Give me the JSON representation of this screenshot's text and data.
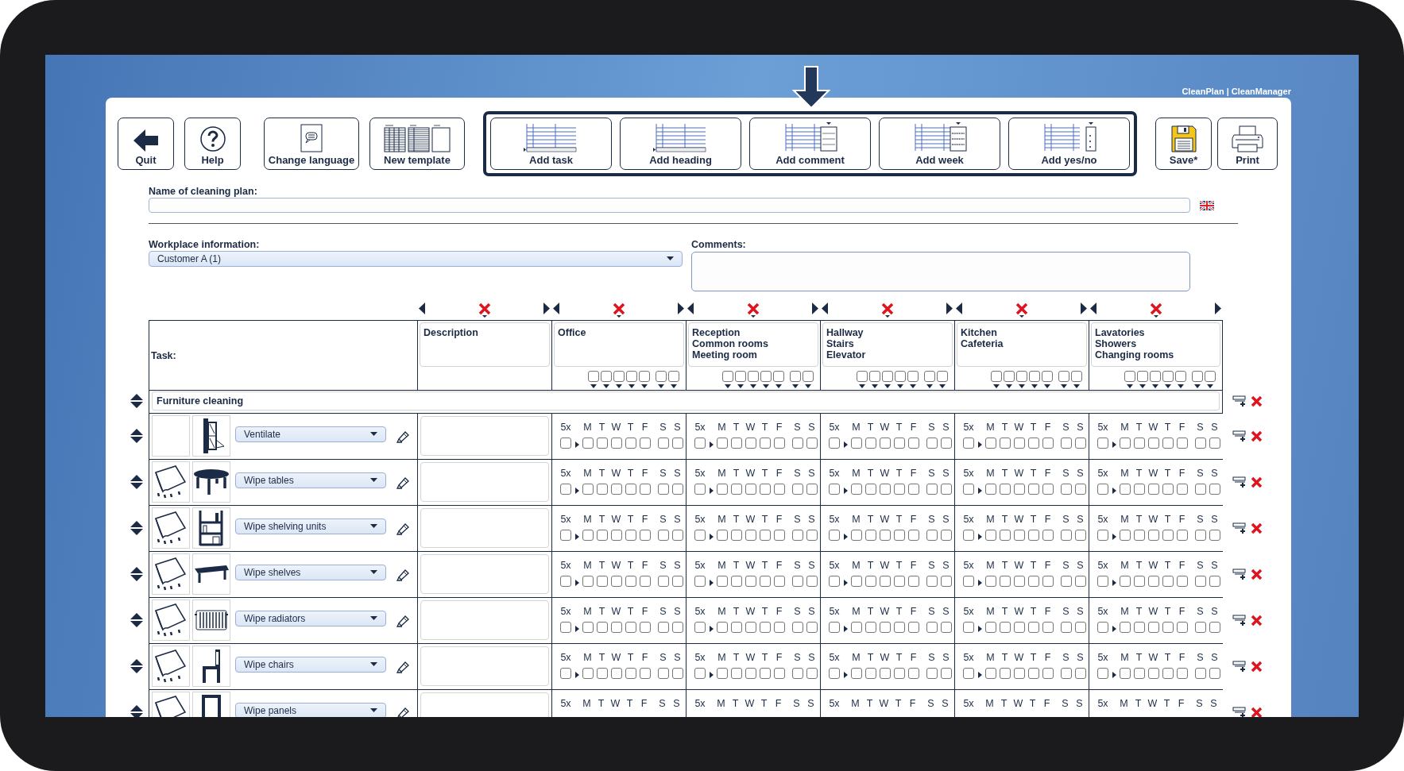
{
  "brand": "CleanPlan | CleanManager",
  "toolbar": {
    "left": [
      {
        "label": "Quit"
      },
      {
        "label": "Help"
      },
      {
        "label": "Change language"
      },
      {
        "label": "New template"
      }
    ],
    "group": [
      {
        "label": "Add task"
      },
      {
        "label": "Add heading"
      },
      {
        "label": "Add comment"
      },
      {
        "label": "Add week"
      },
      {
        "label": "Add yes/no"
      }
    ],
    "right": [
      {
        "label": "Save*"
      },
      {
        "label": "Print"
      }
    ]
  },
  "plan_name": {
    "label": "Name of cleaning plan:"
  },
  "workplace": {
    "label": "Workplace information:",
    "value": "Customer A (1)"
  },
  "comments": {
    "label": "Comments:"
  },
  "table": {
    "task_label": "Task:",
    "columns": [
      {
        "kind": "text",
        "title": "Description"
      },
      {
        "kind": "week",
        "title": "Office",
        "checked": [
          false,
          false,
          false,
          false,
          false,
          false,
          false
        ]
      },
      {
        "kind": "week",
        "title": "Reception\nCommon rooms\nMeeting room",
        "checked": [
          false,
          false,
          false,
          false,
          false,
          false,
          false
        ]
      },
      {
        "kind": "week",
        "title": "Hallway\nStairs\nElevator",
        "checked": [
          false,
          false,
          false,
          false,
          false,
          false,
          false
        ]
      },
      {
        "kind": "week",
        "title": "Kitchen\nCafeteria",
        "checked": [
          false,
          false,
          false,
          false,
          false,
          false,
          false
        ]
      },
      {
        "kind": "week",
        "title": "Lavatories\nShowers\nChanging rooms",
        "checked": [
          false,
          false,
          false,
          false,
          false,
          false,
          false
        ]
      }
    ],
    "sections": [
      {
        "title": "Furniture cleaning",
        "tasks": [
          {
            "name": "Ventilate",
            "cells": [
              {
                "freq": "5x",
                "days": [
                  "M",
                  "T",
                  "W",
                  "T",
                  "F",
                  "S",
                  "S"
                ],
                "checked": [
                  false,
                  false,
                  false,
                  false,
                  false,
                  false,
                  false,
                  false
                ]
              },
              {
                "freq": "5x",
                "days": [
                  "M",
                  "T",
                  "W",
                  "T",
                  "F",
                  "S",
                  "S"
                ],
                "checked": [
                  false,
                  false,
                  false,
                  false,
                  false,
                  false,
                  false,
                  false
                ]
              },
              {
                "freq": "5x",
                "days": [
                  "M",
                  "T",
                  "W",
                  "T",
                  "F",
                  "S",
                  "S"
                ],
                "checked": [
                  false,
                  false,
                  false,
                  false,
                  false,
                  false,
                  false,
                  false
                ]
              },
              {
                "freq": "5x",
                "days": [
                  "M",
                  "T",
                  "W",
                  "T",
                  "F",
                  "S",
                  "S"
                ],
                "checked": [
                  false,
                  false,
                  false,
                  false,
                  false,
                  false,
                  false,
                  false
                ]
              },
              {
                "freq": "5x",
                "days": [
                  "M",
                  "T",
                  "W",
                  "T",
                  "F",
                  "S",
                  "S"
                ],
                "checked": [
                  false,
                  false,
                  false,
                  false,
                  false,
                  false,
                  false,
                  false
                ]
              }
            ]
          },
          {
            "name": "Wipe tables",
            "cells": [
              {
                "freq": "5x",
                "days": [
                  "M",
                  "T",
                  "W",
                  "T",
                  "F",
                  "S",
                  "S"
                ],
                "checked": [
                  false,
                  false,
                  false,
                  false,
                  false,
                  false,
                  false,
                  false
                ]
              },
              {
                "freq": "5x",
                "days": [
                  "M",
                  "T",
                  "W",
                  "T",
                  "F",
                  "S",
                  "S"
                ],
                "checked": [
                  false,
                  false,
                  false,
                  false,
                  false,
                  false,
                  false,
                  false
                ]
              },
              {
                "freq": "5x",
                "days": [
                  "M",
                  "T",
                  "W",
                  "T",
                  "F",
                  "S",
                  "S"
                ],
                "checked": [
                  false,
                  false,
                  false,
                  false,
                  false,
                  false,
                  false,
                  false
                ]
              },
              {
                "freq": "5x",
                "days": [
                  "M",
                  "T",
                  "W",
                  "T",
                  "F",
                  "S",
                  "S"
                ],
                "checked": [
                  false,
                  false,
                  false,
                  false,
                  false,
                  false,
                  false,
                  false
                ]
              },
              {
                "freq": "5x",
                "days": [
                  "M",
                  "T",
                  "W",
                  "T",
                  "F",
                  "S",
                  "S"
                ],
                "checked": [
                  false,
                  false,
                  false,
                  false,
                  false,
                  false,
                  false,
                  false
                ]
              }
            ]
          },
          {
            "name": "Wipe shelving units",
            "cells": [
              {
                "freq": "5x",
                "days": [
                  "M",
                  "T",
                  "W",
                  "T",
                  "F",
                  "S",
                  "S"
                ],
                "checked": [
                  false,
                  false,
                  false,
                  false,
                  false,
                  false,
                  false,
                  false
                ]
              },
              {
                "freq": "5x",
                "days": [
                  "M",
                  "T",
                  "W",
                  "T",
                  "F",
                  "S",
                  "S"
                ],
                "checked": [
                  false,
                  false,
                  false,
                  false,
                  false,
                  false,
                  false,
                  false
                ]
              },
              {
                "freq": "5x",
                "days": [
                  "M",
                  "T",
                  "W",
                  "T",
                  "F",
                  "S",
                  "S"
                ],
                "checked": [
                  false,
                  false,
                  false,
                  false,
                  false,
                  false,
                  false,
                  false
                ]
              },
              {
                "freq": "5x",
                "days": [
                  "M",
                  "T",
                  "W",
                  "T",
                  "F",
                  "S",
                  "S"
                ],
                "checked": [
                  false,
                  false,
                  false,
                  false,
                  false,
                  false,
                  false,
                  false
                ]
              },
              {
                "freq": "5x",
                "days": [
                  "M",
                  "T",
                  "W",
                  "T",
                  "F",
                  "S",
                  "S"
                ],
                "checked": [
                  false,
                  false,
                  false,
                  false,
                  false,
                  false,
                  false,
                  false
                ]
              }
            ]
          },
          {
            "name": "Wipe shelves",
            "cells": [
              {
                "freq": "5x",
                "days": [
                  "M",
                  "T",
                  "W",
                  "T",
                  "F",
                  "S",
                  "S"
                ],
                "checked": [
                  false,
                  false,
                  false,
                  false,
                  false,
                  false,
                  false,
                  false
                ]
              },
              {
                "freq": "5x",
                "days": [
                  "M",
                  "T",
                  "W",
                  "T",
                  "F",
                  "S",
                  "S"
                ],
                "checked": [
                  false,
                  false,
                  false,
                  false,
                  false,
                  false,
                  false,
                  false
                ]
              },
              {
                "freq": "5x",
                "days": [
                  "M",
                  "T",
                  "W",
                  "T",
                  "F",
                  "S",
                  "S"
                ],
                "checked": [
                  false,
                  false,
                  false,
                  false,
                  false,
                  false,
                  false,
                  false
                ]
              },
              {
                "freq": "5x",
                "days": [
                  "M",
                  "T",
                  "W",
                  "T",
                  "F",
                  "S",
                  "S"
                ],
                "checked": [
                  false,
                  false,
                  false,
                  false,
                  false,
                  false,
                  false,
                  false
                ]
              },
              {
                "freq": "5x",
                "days": [
                  "M",
                  "T",
                  "W",
                  "T",
                  "F",
                  "S",
                  "S"
                ],
                "checked": [
                  false,
                  false,
                  false,
                  false,
                  false,
                  false,
                  false,
                  false
                ]
              }
            ]
          },
          {
            "name": "Wipe radiators",
            "cells": [
              {
                "freq": "5x",
                "days": [
                  "M",
                  "T",
                  "W",
                  "T",
                  "F",
                  "S",
                  "S"
                ],
                "checked": [
                  false,
                  false,
                  false,
                  false,
                  false,
                  false,
                  false,
                  false
                ]
              },
              {
                "freq": "5x",
                "days": [
                  "M",
                  "T",
                  "W",
                  "T",
                  "F",
                  "S",
                  "S"
                ],
                "checked": [
                  false,
                  false,
                  false,
                  false,
                  false,
                  false,
                  false,
                  false
                ]
              },
              {
                "freq": "5x",
                "days": [
                  "M",
                  "T",
                  "W",
                  "T",
                  "F",
                  "S",
                  "S"
                ],
                "checked": [
                  false,
                  false,
                  false,
                  false,
                  false,
                  false,
                  false,
                  false
                ]
              },
              {
                "freq": "5x",
                "days": [
                  "M",
                  "T",
                  "W",
                  "T",
                  "F",
                  "S",
                  "S"
                ],
                "checked": [
                  false,
                  false,
                  false,
                  false,
                  false,
                  false,
                  false,
                  false
                ]
              },
              {
                "freq": "5x",
                "days": [
                  "M",
                  "T",
                  "W",
                  "T",
                  "F",
                  "S",
                  "S"
                ],
                "checked": [
                  false,
                  false,
                  false,
                  false,
                  false,
                  false,
                  false,
                  false
                ]
              }
            ]
          },
          {
            "name": "Wipe chairs",
            "cells": [
              {
                "freq": "5x",
                "days": [
                  "M",
                  "T",
                  "W",
                  "T",
                  "F",
                  "S",
                  "S"
                ],
                "checked": [
                  false,
                  false,
                  false,
                  false,
                  false,
                  false,
                  false,
                  false
                ]
              },
              {
                "freq": "5x",
                "days": [
                  "M",
                  "T",
                  "W",
                  "T",
                  "F",
                  "S",
                  "S"
                ],
                "checked": [
                  false,
                  false,
                  false,
                  false,
                  false,
                  false,
                  false,
                  false
                ]
              },
              {
                "freq": "5x",
                "days": [
                  "M",
                  "T",
                  "W",
                  "T",
                  "F",
                  "S",
                  "S"
                ],
                "checked": [
                  false,
                  false,
                  false,
                  false,
                  false,
                  false,
                  false,
                  false
                ]
              },
              {
                "freq": "5x",
                "days": [
                  "M",
                  "T",
                  "W",
                  "T",
                  "F",
                  "S",
                  "S"
                ],
                "checked": [
                  false,
                  false,
                  false,
                  false,
                  false,
                  false,
                  false,
                  false
                ]
              },
              {
                "freq": "5x",
                "days": [
                  "M",
                  "T",
                  "W",
                  "T",
                  "F",
                  "S",
                  "S"
                ],
                "checked": [
                  false,
                  false,
                  false,
                  false,
                  false,
                  false,
                  false,
                  false
                ]
              }
            ]
          },
          {
            "name": "Wipe panels",
            "cells": [
              {
                "freq": "5x",
                "days": [
                  "M",
                  "T",
                  "W",
                  "T",
                  "F",
                  "S",
                  "S"
                ]
              },
              {
                "freq": "5x",
                "days": [
                  "M",
                  "T",
                  "W",
                  "T",
                  "F",
                  "S",
                  "S"
                ]
              },
              {
                "freq": "5x",
                "days": [
                  "M",
                  "T",
                  "W",
                  "T",
                  "F",
                  "S",
                  "S"
                ]
              },
              {
                "freq": "5x",
                "days": [
                  "M",
                  "T",
                  "W",
                  "T",
                  "F",
                  "S",
                  "S"
                ]
              },
              {
                "freq": "5x",
                "days": [
                  "M",
                  "T",
                  "W",
                  "T",
                  "F",
                  "S",
                  "S"
                ]
              }
            ]
          }
        ]
      }
    ]
  }
}
